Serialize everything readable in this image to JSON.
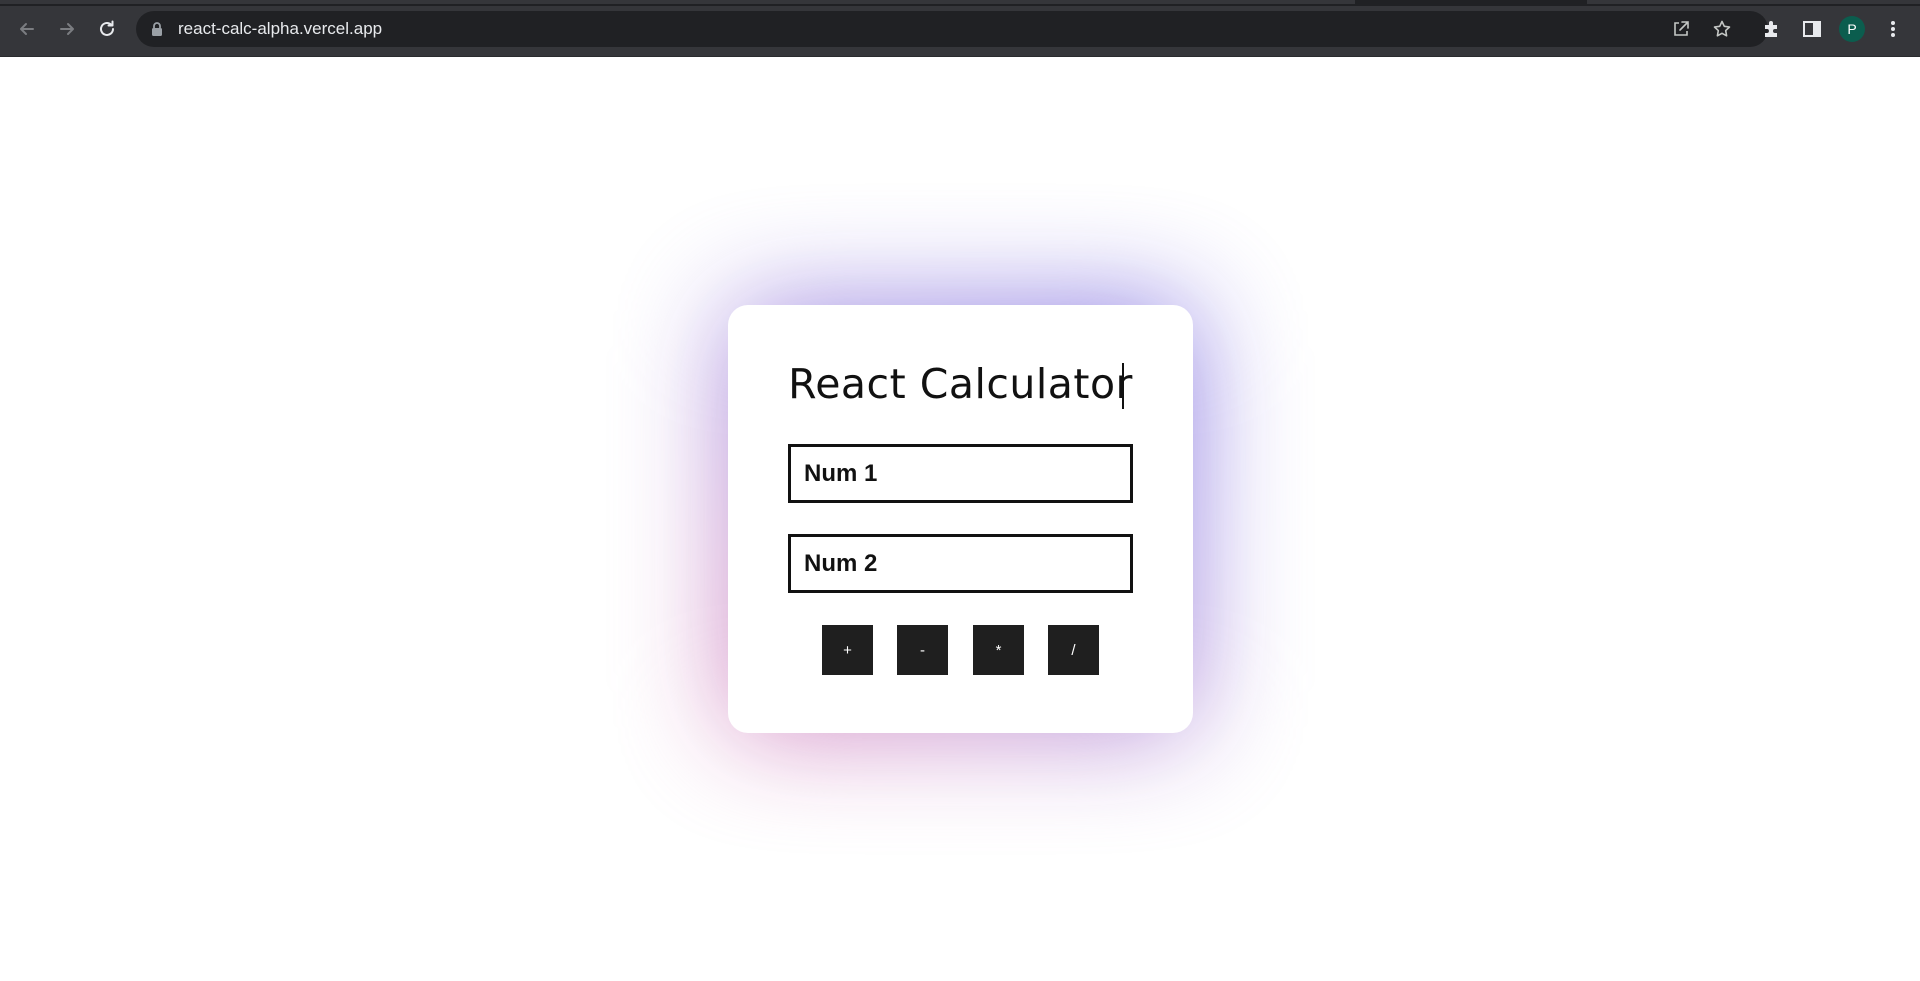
{
  "browser": {
    "url": "react-calc-alpha.vercel.app",
    "profile_initial": "P",
    "icons": {
      "back": "arrow-left-icon",
      "forward": "arrow-right-icon",
      "reload": "reload-icon",
      "lock": "lock-icon",
      "share": "share-icon",
      "bookmark": "star-icon",
      "extensions": "puzzle-icon",
      "side_panel": "side-panel-icon",
      "menu": "kebab-menu-icon"
    }
  },
  "calculator": {
    "title": "React Calculator",
    "num1": {
      "placeholder": "Num 1",
      "value": ""
    },
    "num2": {
      "placeholder": "Num 2",
      "value": ""
    },
    "operations": [
      "+",
      "-",
      "*",
      "/"
    ]
  },
  "colors": {
    "chrome_bg": "#35363a",
    "omnibox_bg": "#202124",
    "glow_violet": "#7d6fe0",
    "glow_pink": "#d57fb8",
    "button_bg": "#1f1f1f",
    "avatar_bg": "#0b5d4e"
  }
}
